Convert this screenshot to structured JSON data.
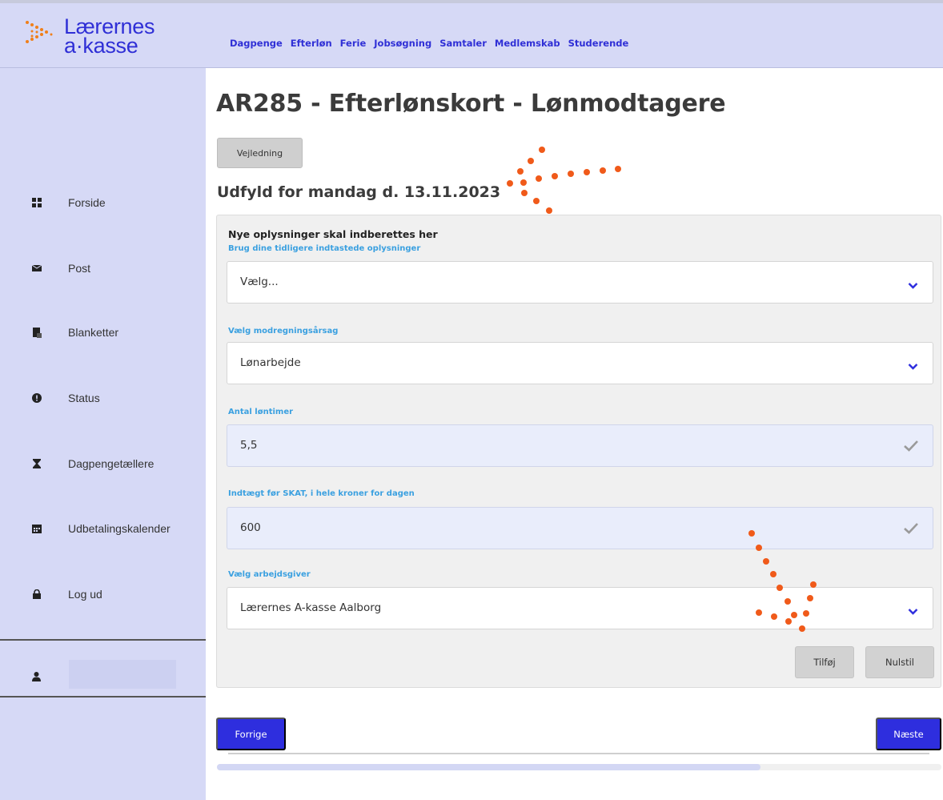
{
  "brand": {
    "line1": "Lærernes",
    "line2": "a·kasse",
    "accent": "#2f2fd6"
  },
  "topnav": [
    "Dagpenge",
    "Efterløn",
    "Ferie",
    "Jobsøgning",
    "Samtaler",
    "Medlemskab",
    "Studerende"
  ],
  "sidebar": {
    "items": [
      {
        "label": "Forside",
        "icon": "grid-icon"
      },
      {
        "label": "Post",
        "icon": "envelope-icon"
      },
      {
        "label": "Blanketter",
        "icon": "form-icon"
      },
      {
        "label": "Status",
        "icon": "info-circle-icon"
      },
      {
        "label": "Dagpengetællere",
        "icon": "hourglass-icon"
      },
      {
        "label": "Udbetalingskalender",
        "icon": "calendar-icon"
      },
      {
        "label": "Log ud",
        "icon": "lock-icon"
      }
    ],
    "user_icon": "user-icon"
  },
  "page": {
    "title": "AR285 - Efterlønskort - Lønmodtagere",
    "guide_button": "Vejledning",
    "subtitle": "Udfyld for mandag d. 13.11.2023"
  },
  "form": {
    "heading": "Nye oplysninger skal indberettes her",
    "previous_label": "Brug dine tidligere indtastede oplysninger",
    "previous_value": "Vælg...",
    "reason_label": "Vælg modregningsårsag",
    "reason_value": "Lønarbejde",
    "hours_label": "Antal løntimer",
    "hours_value": "5,5",
    "income_label": "Indtægt før SKAT, i hele kroner for dagen",
    "income_value": "600",
    "employer_label": "Vælg arbejdsgiver",
    "employer_value": "Lærernes A-kasse Aalborg",
    "add_button": "Tilføj",
    "reset_button": "Nulstil"
  },
  "footer": {
    "prev_button": "Forrige",
    "next_button": "Næste",
    "progress": 0.75
  },
  "colors": {
    "annotation": "#f05a1a",
    "label_blue": "#3aa0e0",
    "button_blue": "#2e2ede"
  }
}
